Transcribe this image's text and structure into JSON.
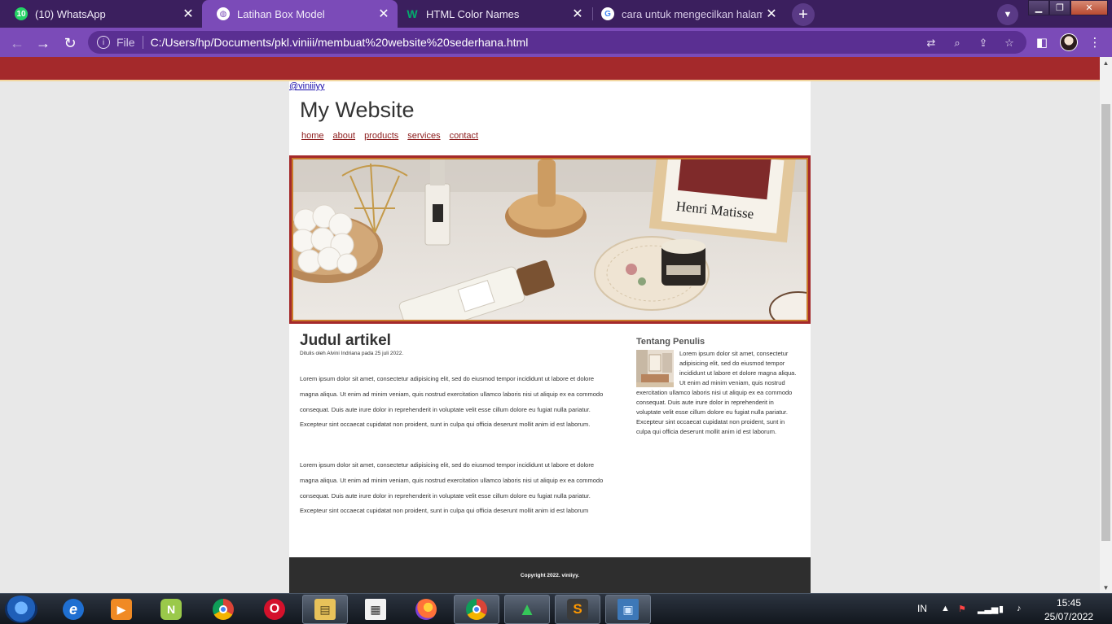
{
  "browser": {
    "tabs": [
      {
        "title": "(10) WhatsApp",
        "icon": "whatsapp-icon",
        "badge": "10",
        "active": false
      },
      {
        "title": "Latihan Box Model",
        "icon": "globe-icon",
        "active": true
      },
      {
        "title": "HTML Color Names",
        "icon": "w3schools-icon",
        "active": false
      },
      {
        "title": "cara untuk mengecilkan halaman",
        "icon": "google-icon",
        "active": false
      }
    ],
    "new_tab_symbol": "+",
    "close_symbol": "✕",
    "address": {
      "scheme_label": "File",
      "url": "C:/Users/hp/Documents/pkl.viniii/membuat%20website%20sederhana.html"
    },
    "theme_color": "#7b4bb8"
  },
  "page": {
    "handle": "@viniiiyy",
    "site_title": "My Website",
    "menu": [
      "home",
      "about",
      "products",
      "services",
      "contact"
    ],
    "hero_caption": "Henri Matisse",
    "article": {
      "title": "Judul artikel",
      "meta": "Ditulis oleh Alvini Indriana pada 25 juli 2022.",
      "paragraphs": [
        "Lorem ipsum dolor sit amet, consectetur adipisicing elit, sed do eiusmod tempor incididunt ut labore et dolore magna aliqua. Ut enim ad minim veniam, quis nostrud exercitation ullamco laboris nisi ut aliquip ex ea commodo consequat. Duis aute irure dolor in reprehenderit in voluptate velit esse cillum dolore eu fugiat nulla pariatur. Excepteur sint occaecat cupidatat non proident, sunt in culpa qui officia deserunt mollit anim id est laborum.",
        "Lorem ipsum dolor sit amet, consectetur adipisicing elit, sed do eiusmod tempor incididunt ut labore et dolore magna aliqua. Ut enim ad minim veniam, quis nostrud exercitation ullamco laboris nisi ut aliquip ex ea commodo consequat. Duis aute irure dolor in reprehenderit in voluptate velit esse cillum dolore eu fugiat nulla pariatur. Excepteur sint occaecat cupidatat non proident, sunt in culpa qui officia deserunt mollit anim id est laborum"
      ]
    },
    "aside": {
      "title": "Tentang Penulis",
      "text": "Lorem ipsum dolor sit amet, consectetur adipisicing elit, sed do eiusmod tempor incididunt ut labore et dolore magna aliqua. Ut enim ad minim veniam, quis nostrud exercitation ullamco laboris nisi ut aliquip ex ea commodo consequat. Duis aute irure dolor in reprehenderit in voluptate velit esse cillum dolore eu fugiat nulla pariatur. Excepteur sint occaecat cupidatat non proident, sunt in culpa qui officia deserunt mollit anim id est laborum."
    },
    "footer": "Copyright 2022. viniiyy.",
    "colors": {
      "band": "#a4292b",
      "footer": "#2e2e2e",
      "link": "#8b1a1a"
    }
  },
  "taskbar": {
    "apps": [
      {
        "name": "internet-explorer-icon",
        "glyph": "e"
      },
      {
        "name": "media-player-icon",
        "glyph": "▶"
      },
      {
        "name": "notepad-plus-icon",
        "glyph": "N"
      },
      {
        "name": "chrome-icon",
        "glyph": ""
      },
      {
        "name": "opera-icon",
        "glyph": "O"
      },
      {
        "name": "file-explorer-icon",
        "glyph": "▤"
      },
      {
        "name": "document-viewer-icon",
        "glyph": "▦"
      },
      {
        "name": "firefox-icon",
        "glyph": ""
      },
      {
        "name": "chrome-profile-icon",
        "glyph": ""
      },
      {
        "name": "excalibur-icon",
        "glyph": "▲"
      },
      {
        "name": "sublime-text-icon",
        "glyph": "S"
      },
      {
        "name": "photo-viewer-icon",
        "glyph": "▣"
      }
    ],
    "language": "IN",
    "time": "15:45",
    "date": "25/07/2022"
  }
}
